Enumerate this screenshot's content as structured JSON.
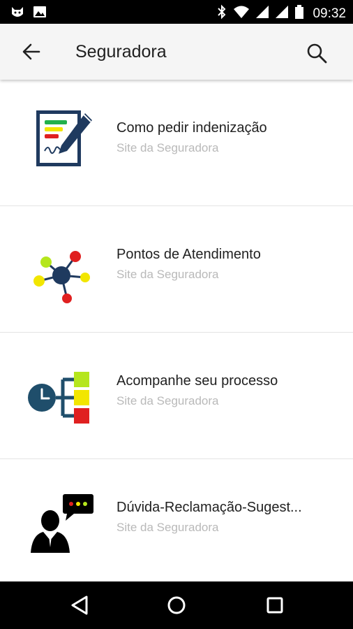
{
  "status_bar": {
    "time": "09:32",
    "icons": [
      "cat-notification-icon",
      "image-notification-icon",
      "bluetooth-icon",
      "wifi-icon",
      "signal-icon",
      "signal-icon",
      "battery-icon"
    ]
  },
  "app_bar": {
    "title": "Seguradora",
    "back_icon": "arrow-back-icon",
    "search_icon": "search-icon"
  },
  "items": [
    {
      "title": "Como pedir indenização",
      "subtitle": "Site da Seguradora",
      "icon": "claim-form-icon"
    },
    {
      "title": "Pontos de Atendimento",
      "subtitle": "Site da Seguradora",
      "icon": "network-nodes-icon"
    },
    {
      "title": "Acompanhe seu processo",
      "subtitle": "Site da Seguradora",
      "icon": "process-tracking-icon"
    },
    {
      "title": "Dúvida-Reclamação-Sugest...",
      "subtitle": "Site da Seguradora",
      "icon": "person-chat-icon"
    }
  ],
  "nav_bar": {
    "back": "triangle-back-icon",
    "home": "circle-home-icon",
    "recents": "square-recents-icon"
  },
  "colors": {
    "status_bar": "#000000",
    "app_bar": "#f5f5f5",
    "navy": "#1f3a5f",
    "green": "#22b14c",
    "yellow": "#f2e600",
    "red": "#e02020",
    "lime": "#b5e61d"
  }
}
